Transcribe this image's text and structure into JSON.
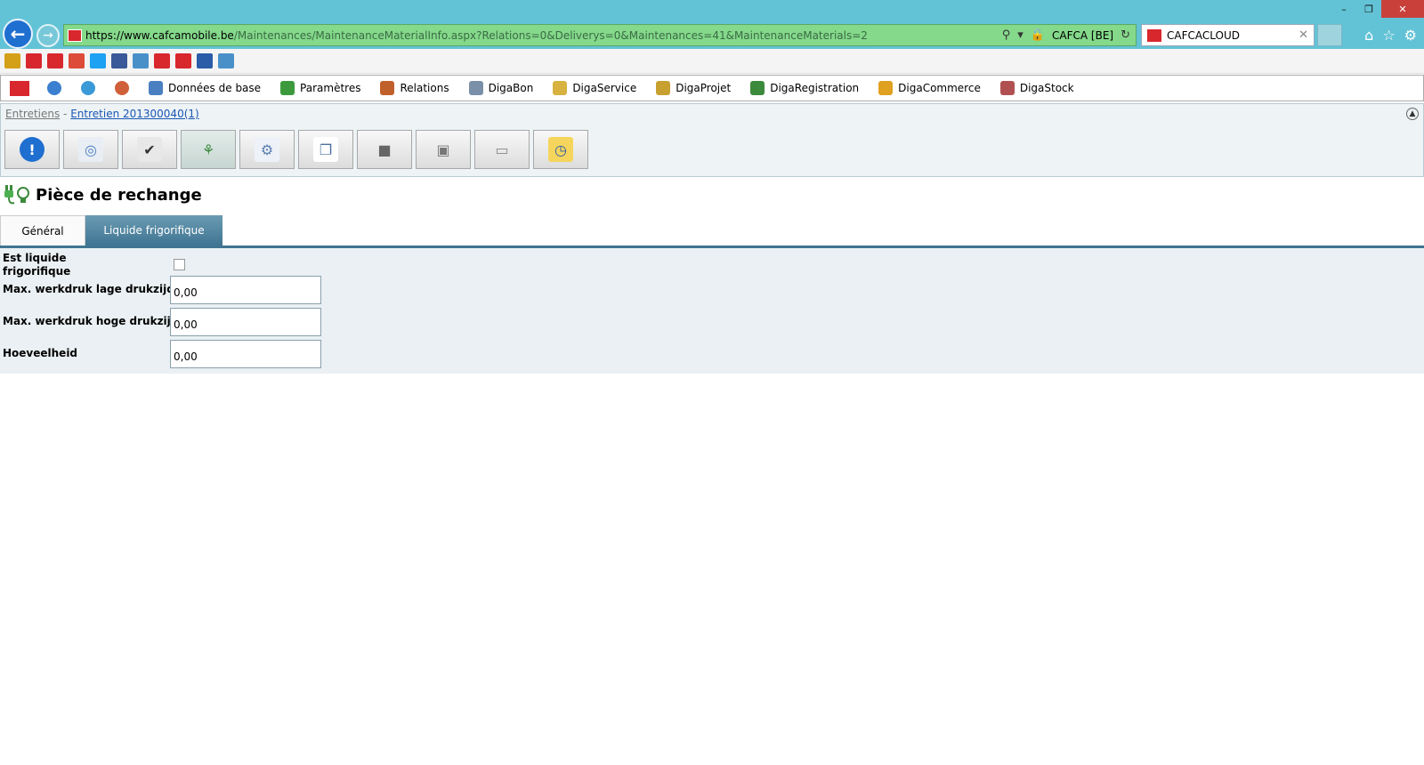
{
  "browser": {
    "url_scheme": "https://www.",
    "url_domain": "cafcamobile.be",
    "url_path": "/Maintenances/MaintenanceMaterialInfo.aspx?Relations=0&Deliverys=0&Maintenances=41&MaintenanceMaterials=2",
    "site_identity": "CAFCA [BE]",
    "tab_title": "CAFCACLOUD"
  },
  "favorites": [
    {
      "icon": "star-add-icon",
      "color": "#d4a017"
    },
    {
      "icon": "e-icon",
      "color": "#d8272d"
    },
    {
      "icon": "cafca-icon",
      "color": "#d8272d"
    },
    {
      "icon": "google-plus-icon",
      "color": "#dd4b39"
    },
    {
      "icon": "twitter-icon",
      "color": "#1da1f2"
    },
    {
      "icon": "facebook-icon",
      "color": "#3b5998"
    },
    {
      "icon": "ie-page-icon",
      "color": "#4a90c8"
    },
    {
      "icon": "cafca-icon",
      "color": "#d8272d"
    },
    {
      "icon": "c-icon",
      "color": "#d8272d"
    },
    {
      "icon": "globe-icon",
      "color": "#2a5ca8"
    },
    {
      "icon": "ie-page-icon",
      "color": "#4a90c8"
    }
  ],
  "menu": {
    "items": [
      {
        "label": "Données de base",
        "icon": "database-icon",
        "color": "#4a7fc1"
      },
      {
        "label": "Paramètres",
        "icon": "gears-icon",
        "color": "#3c9a3c"
      },
      {
        "label": "Relations",
        "icon": "people-icon",
        "color": "#c0602a"
      },
      {
        "label": "DigaBon",
        "icon": "document-icon",
        "color": "#7a8fa8"
      },
      {
        "label": "DigaService",
        "icon": "service-icon",
        "color": "#d8b240"
      },
      {
        "label": "DigaProjet",
        "icon": "project-icon",
        "color": "#c8a030"
      },
      {
        "label": "DigaRegistration",
        "icon": "registration-icon",
        "color": "#3c8a3c"
      },
      {
        "label": "DigaCommerce",
        "icon": "coin-icon",
        "color": "#e0a020"
      },
      {
        "label": "DigaStock",
        "icon": "stock-icon",
        "color": "#b05050"
      }
    ]
  },
  "breadcrumb": {
    "root": "Entretiens",
    "separator": " - ",
    "current": "Entretien 201300040(1)"
  },
  "toolbar": [
    {
      "icon": "info-icon",
      "active": false
    },
    {
      "icon": "washing-machine-icon",
      "active": false
    },
    {
      "icon": "checklist-icon",
      "active": false
    },
    {
      "icon": "plug-bulb-icon",
      "active": true
    },
    {
      "icon": "settings-document-icon",
      "active": false
    },
    {
      "icon": "copy-documents-icon",
      "active": false
    },
    {
      "icon": "notebook-icon",
      "active": false
    },
    {
      "icon": "printer-icon",
      "active": false
    },
    {
      "icon": "folder-icon",
      "active": false
    },
    {
      "icon": "folder-clock-icon",
      "active": false
    }
  ],
  "page": {
    "title": "Pièce de rechange"
  },
  "tabs": {
    "general": "Général",
    "liquide": "Liquide frigorifique"
  },
  "form": {
    "is_refrigerant_label": "Est liquide frigorifique",
    "is_refrigerant_checked": false,
    "max_low_label": "Max. werkdruk lage drukzijde",
    "max_low_value": "0,00",
    "max_high_label": "Max. werkdruk hoge drukzijde",
    "max_high_value": "0,00",
    "quantity_label": "Hoeveelheid",
    "quantity_value": "0,00"
  },
  "colors": {
    "chrome": "#63c3d6",
    "addr_bar": "#84d98a",
    "tab_active": "#3f7592",
    "link": "#1a57b5"
  }
}
